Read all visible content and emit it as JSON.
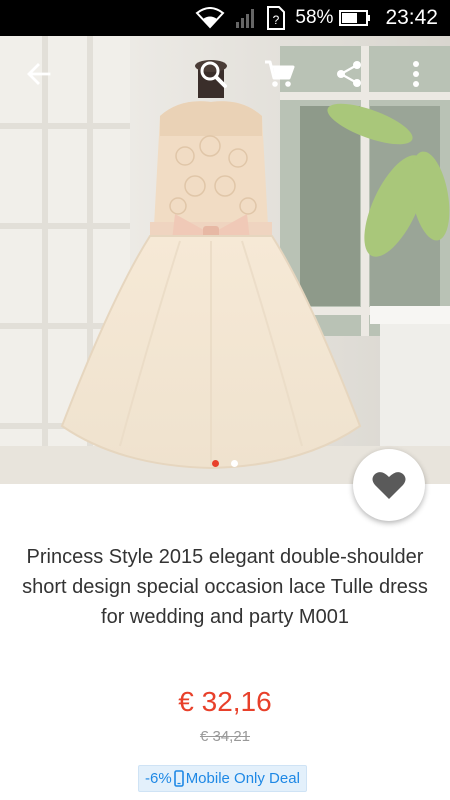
{
  "status_bar": {
    "battery": "58%",
    "time": "23:42",
    "icons": [
      "wifi-icon",
      "signal-icon",
      "sim-unknown-icon",
      "battery-icon"
    ]
  },
  "toolbar": {
    "icons": [
      "back-arrow-icon",
      "search-icon",
      "cart-icon",
      "share-icon",
      "more-vert-icon"
    ]
  },
  "product": {
    "title": "Princess Style 2015 elegant double-shoulder short design special occasion lace Tulle dress for wedding and party M001",
    "price": "€ 32,16",
    "old_price": "€ 34,21",
    "deal_discount": "-6%",
    "deal_label": "Mobile Only Deal"
  },
  "gallery": {
    "page_count": 2,
    "active_index": 0
  },
  "colors": {
    "price": "#e8402a",
    "deal_text": "#1e88e5",
    "deal_bg": "#e3f0fb"
  }
}
